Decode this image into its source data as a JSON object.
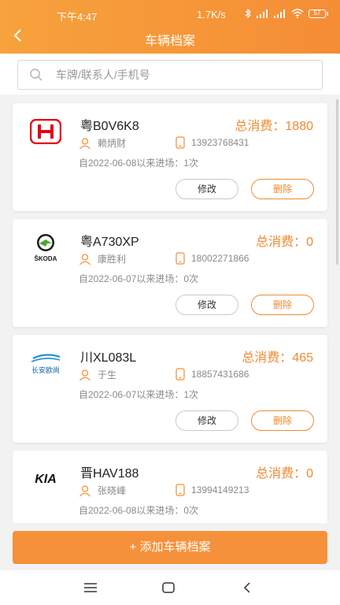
{
  "status_bar": {
    "time": "下午4:47",
    "network_speed": "1.7K/s",
    "battery": "57"
  },
  "header": {
    "title": "车辆档案"
  },
  "search": {
    "placeholder": "车牌/联系人/手机号",
    "value": ""
  },
  "labels": {
    "total_prefix": "总消费：",
    "edit": "修改",
    "delete": "删除"
  },
  "vehicles": [
    {
      "brand": "Honda",
      "logo_icon": "honda-logo-icon",
      "plate": "粤B0V6K8",
      "total": "1880",
      "contact": "赖炳财",
      "phone": "13923768431",
      "since": "自2022-06-08以来进场：1次"
    },
    {
      "brand": "Skoda",
      "logo_icon": "skoda-logo-icon",
      "logo_text": "ŠKODA",
      "plate": "粤A730XP",
      "total": "0",
      "contact": "康胜利",
      "phone": "18002271866",
      "since": "自2022-06-07以来进场：0次"
    },
    {
      "brand": "Changan Oushang",
      "logo_icon": "changan-oushang-logo-icon",
      "logo_text": "长安欧尚",
      "plate": "川XL083L",
      "total": "465",
      "contact": "于生",
      "phone": "18857431686",
      "since": "自2022-06-07以来进场：1次"
    },
    {
      "brand": "Kia",
      "logo_icon": "kia-logo-icon",
      "logo_text": "KIA",
      "plate": "晋HAV188",
      "total": "0",
      "contact": "张晓峰",
      "phone": "13994149213",
      "since": "自2022-06-08以来进场：0次"
    }
  ],
  "add_button": {
    "label": "+ 添加车辆档案"
  },
  "colors": {
    "accent": "#f5913a",
    "header_start": "#f7a23d",
    "header_end": "#f58d35",
    "honda_red": "#e60012",
    "skoda_green": "#4ba82e"
  }
}
